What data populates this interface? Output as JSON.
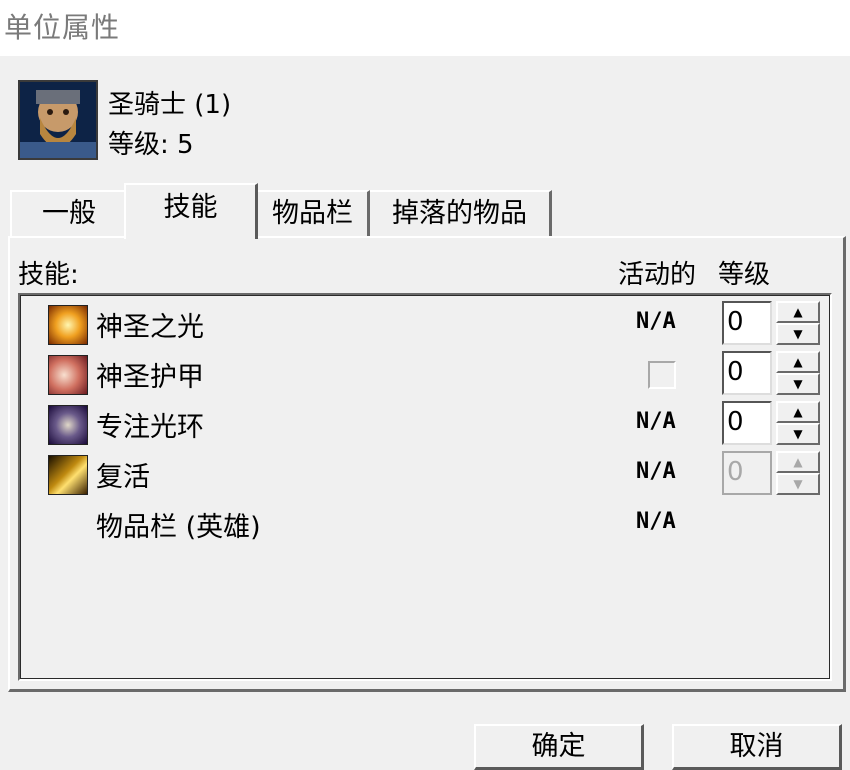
{
  "window": {
    "title": "单位属性"
  },
  "unit": {
    "name": "圣骑士 (1)",
    "level": "等级: 5"
  },
  "tabs": [
    {
      "label": "一般",
      "active": false
    },
    {
      "label": "技能",
      "active": true
    },
    {
      "label": "物品栏",
      "active": false
    },
    {
      "label": "掉落的物品",
      "active": false
    }
  ],
  "skills_panel": {
    "label": "技能:",
    "col_active": "活动的",
    "col_level": "等级",
    "rows": [
      {
        "name": "神圣之光",
        "icon": "holy-light-icon",
        "active": "N/A",
        "level": "0",
        "level_enabled": true
      },
      {
        "name": "神圣护甲",
        "icon": "divine-shield-icon",
        "active": "",
        "active_checkbox": true,
        "level": "0",
        "level_enabled": true
      },
      {
        "name": "专注光环",
        "icon": "devotion-aura-icon",
        "active": "N/A",
        "level": "0",
        "level_enabled": true
      },
      {
        "name": "复活",
        "icon": "resurrection-icon",
        "active": "N/A",
        "level": "0",
        "level_enabled": false
      },
      {
        "name": "物品栏 (英雄)",
        "icon": "",
        "active": "N/A"
      }
    ]
  },
  "buttons": {
    "ok": "确定",
    "cancel": "取消"
  },
  "colors": {
    "background": "#f0f0f0",
    "border_dark": "#6a6a6a",
    "disabled_text": "#a8a8a8"
  }
}
